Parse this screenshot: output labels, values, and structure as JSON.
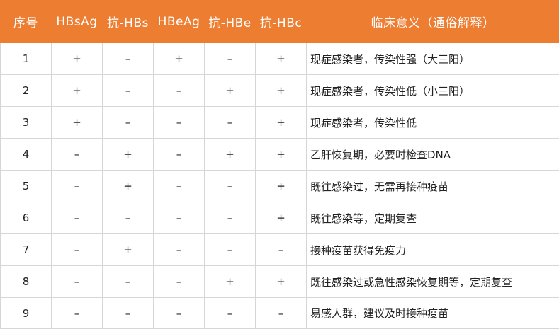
{
  "headers": [
    "序号",
    "HBsAg",
    "抗-HBs",
    "HBeAg",
    "抗-HBe",
    "抗-HBc",
    "临床意义（通俗解释）"
  ],
  "rows": [
    {
      "no": "1",
      "hbsag": "+",
      "anti_hbs": "–",
      "hbeag": "+",
      "anti_hbe": "–",
      "anti_hbc": "+",
      "meaning": "现症感染者，传染性强（大三阳）"
    },
    {
      "no": "2",
      "hbsag": "+",
      "anti_hbs": "–",
      "hbeag": "–",
      "anti_hbe": "+",
      "anti_hbc": "+",
      "meaning": "现症感染者，传染性低（小三阳）"
    },
    {
      "no": "3",
      "hbsag": "+",
      "anti_hbs": "–",
      "hbeag": "–",
      "anti_hbe": "–",
      "anti_hbc": "+",
      "meaning": "现症感染者，传染性低"
    },
    {
      "no": "4",
      "hbsag": "–",
      "anti_hbs": "+",
      "hbeag": "–",
      "anti_hbe": "+",
      "anti_hbc": "+",
      "meaning": "乙肝恢复期，必要时检查DNA"
    },
    {
      "no": "5",
      "hbsag": "–",
      "anti_hbs": "+",
      "hbeag": "–",
      "anti_hbe": "–",
      "anti_hbc": "+",
      "meaning": "既往感染过，无需再接种疫苗"
    },
    {
      "no": "6",
      "hbsag": "–",
      "anti_hbs": "–",
      "hbeag": "–",
      "anti_hbe": "–",
      "anti_hbc": "+",
      "meaning": "既往感染等，定期复查"
    },
    {
      "no": "7",
      "hbsag": "–",
      "anti_hbs": "+",
      "hbeag": "–",
      "anti_hbe": "–",
      "anti_hbc": "–",
      "meaning": "接种疫苗获得免疫力"
    },
    {
      "no": "8",
      "hbsag": "–",
      "anti_hbs": "–",
      "hbeag": "–",
      "anti_hbe": "+",
      "anti_hbc": "+",
      "meaning": "既往感染过或急性感染恢复期等，定期复查"
    },
    {
      "no": "9",
      "hbsag": "–",
      "anti_hbs": "–",
      "hbeag": "–",
      "anti_hbe": "–",
      "anti_hbc": "–",
      "meaning": "易感人群，建议及时接种疫苗"
    }
  ],
  "colors": {
    "header_bg": "#ED7D31",
    "header_text": "#FFFFFF",
    "grid_line": "#D6D6D6"
  }
}
